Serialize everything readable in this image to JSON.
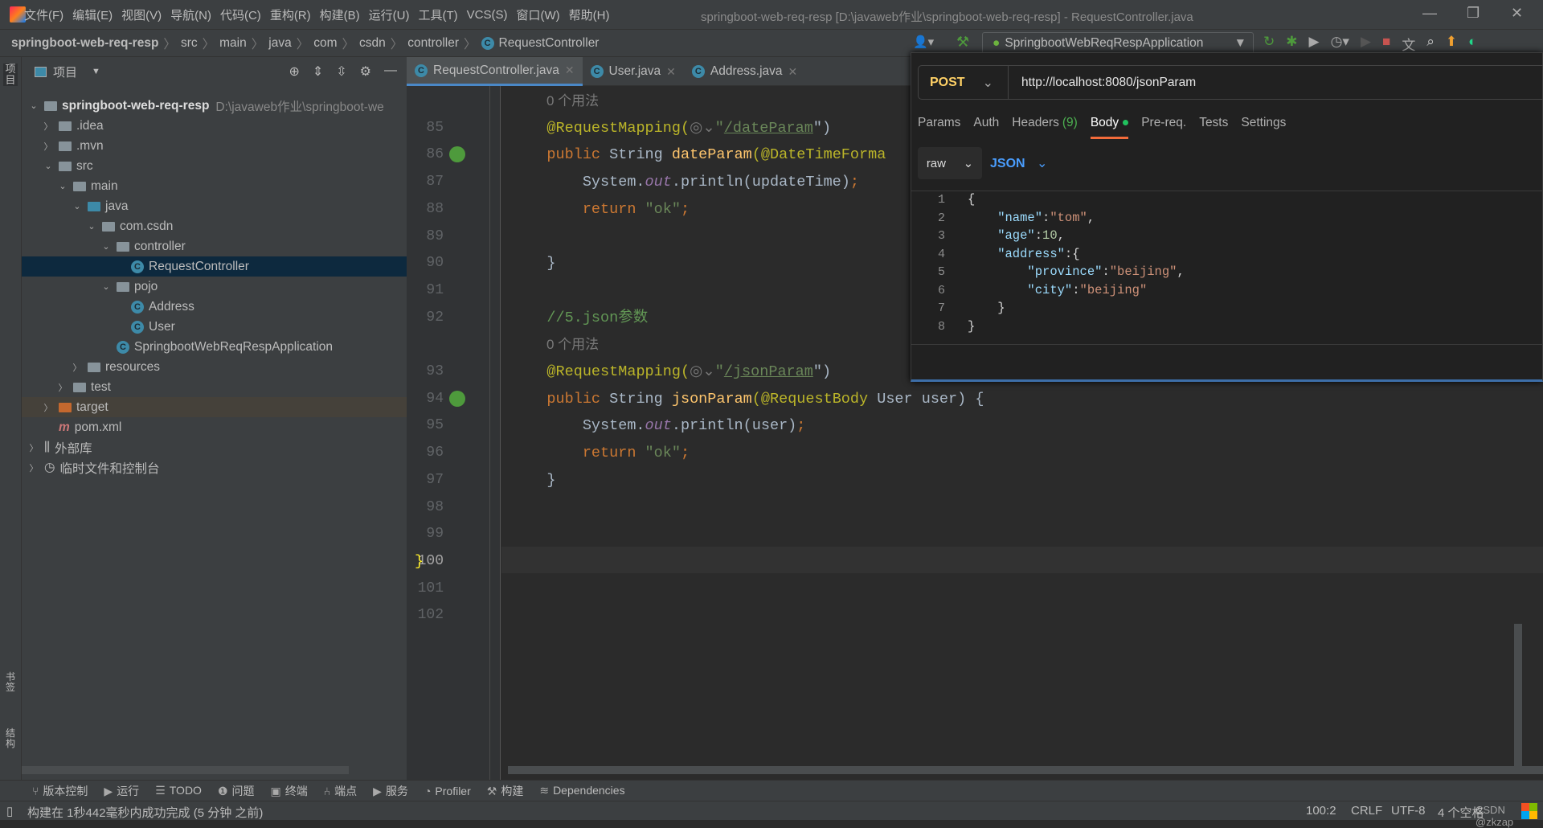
{
  "menu": [
    "文件(F)",
    "编辑(E)",
    "视图(V)",
    "导航(N)",
    "代码(C)",
    "重构(R)",
    "构建(B)",
    "运行(U)",
    "工具(T)",
    "VCS(S)",
    "窗口(W)",
    "帮助(H)"
  ],
  "window_title": "springboot-web-req-resp [D:\\javaweb作业\\springboot-web-req-resp] - RequestController.java",
  "breadcrumb": [
    "springboot-web-req-resp",
    "src",
    "main",
    "java",
    "com",
    "csdn",
    "controller",
    "RequestController"
  ],
  "run_config": "SpringbootWebReqRespApplication",
  "left_strip": {
    "project": "项目",
    "bookmarks": "书签",
    "structure": "结构"
  },
  "project_panel": {
    "title": "项目",
    "tree": [
      {
        "label": "springboot-web-req-resp",
        "path": "D:\\javaweb作业\\springboot-we",
        "depth": 0,
        "exp": "v",
        "icon": "module"
      },
      {
        "label": ".idea",
        "depth": 1,
        "exp": ">",
        "icon": "folder"
      },
      {
        "label": ".mvn",
        "depth": 1,
        "exp": ">",
        "icon": "folder"
      },
      {
        "label": "src",
        "depth": 1,
        "exp": "v",
        "icon": "folder"
      },
      {
        "label": "main",
        "depth": 2,
        "exp": "v",
        "icon": "folder"
      },
      {
        "label": "java",
        "depth": 3,
        "exp": "v",
        "icon": "folder-blue"
      },
      {
        "label": "com.csdn",
        "depth": 4,
        "exp": "v",
        "icon": "package"
      },
      {
        "label": "controller",
        "depth": 5,
        "exp": "v",
        "icon": "package"
      },
      {
        "label": "RequestController",
        "depth": 6,
        "exp": "",
        "icon": "class",
        "selected": true
      },
      {
        "label": "pojo",
        "depth": 5,
        "exp": "v",
        "icon": "package"
      },
      {
        "label": "Address",
        "depth": 6,
        "exp": "",
        "icon": "class"
      },
      {
        "label": "User",
        "depth": 6,
        "exp": "",
        "icon": "class"
      },
      {
        "label": "SpringbootWebReqRespApplication",
        "depth": 5,
        "exp": "",
        "icon": "spring-class"
      },
      {
        "label": "resources",
        "depth": 3,
        "exp": ">",
        "icon": "folder"
      },
      {
        "label": "test",
        "depth": 2,
        "exp": ">",
        "icon": "folder"
      },
      {
        "label": "target",
        "depth": 1,
        "exp": ">",
        "icon": "folder-orange",
        "target": true
      },
      {
        "label": "pom.xml",
        "depth": 1,
        "exp": "",
        "icon": "maven"
      },
      {
        "label": "外部库",
        "depth": 0,
        "exp": ">",
        "icon": "library"
      },
      {
        "label": "临时文件和控制台",
        "depth": 0,
        "exp": ">",
        "icon": "scratch"
      }
    ]
  },
  "tabs": [
    {
      "label": "RequestController.java",
      "active": true
    },
    {
      "label": "User.java"
    },
    {
      "label": "Address.java"
    }
  ],
  "code_lines": [
    {
      "type": "hint",
      "text": "0 个用法"
    },
    {
      "n": "85",
      "tokens": [
        [
          "    ",
          "#555"
        ],
        [
          "@RequestMapping(",
          "#bbb529"
        ],
        [
          "◎⌄",
          "#777"
        ],
        [
          "\"",
          "#6a8759"
        ],
        [
          "/dateParam",
          "#6a8759"
        ],
        [
          "\")",
          "#a9b7c6"
        ]
      ]
    },
    {
      "n": "86",
      "run": true,
      "tokens": [
        [
          "    ",
          "#555"
        ],
        [
          "public ",
          "#cc7832"
        ],
        [
          "String ",
          "#a9b7c6"
        ],
        [
          "dateParam",
          "#ffc66d"
        ],
        [
          "(@DateTimeForma",
          "#bbb529"
        ]
      ]
    },
    {
      "n": "87",
      "tokens": [
        [
          "        System.",
          "#a9b7c6"
        ],
        [
          "out",
          "#9876aa"
        ],
        [
          ".println(updateTime)",
          "#a9b7c6"
        ],
        [
          ";",
          "#cc7832"
        ]
      ]
    },
    {
      "n": "88",
      "tokens": [
        [
          "        ",
          "#555"
        ],
        [
          "return ",
          "#cc7832"
        ],
        [
          "\"ok\"",
          "#6a8759"
        ],
        [
          ";",
          "#cc7832"
        ]
      ]
    },
    {
      "n": "89",
      "tokens": []
    },
    {
      "n": "90",
      "tokens": [
        [
          "    }",
          "#a9b7c6"
        ]
      ]
    },
    {
      "n": "91",
      "tokens": []
    },
    {
      "n": "92",
      "tokens": [
        [
          "    //5.json参数",
          "#629755"
        ]
      ]
    },
    {
      "type": "hint",
      "text": "0 个用法"
    },
    {
      "n": "93",
      "tokens": [
        [
          "    ",
          "#555"
        ],
        [
          "@RequestMapping(",
          "#bbb529"
        ],
        [
          "◎⌄",
          "#777"
        ],
        [
          "\"",
          "#6a8759"
        ],
        [
          "/jsonParam",
          "#6a8759"
        ],
        [
          "\")",
          "#a9b7c6"
        ]
      ]
    },
    {
      "n": "94",
      "run": true,
      "tokens": [
        [
          "    ",
          "#555"
        ],
        [
          "public ",
          "#cc7832"
        ],
        [
          "String ",
          "#a9b7c6"
        ],
        [
          "jsonParam",
          "#ffc66d"
        ],
        [
          "(@RequestBody ",
          "#bbb529"
        ],
        [
          "User user) {",
          "#a9b7c6"
        ]
      ]
    },
    {
      "n": "95",
      "tokens": [
        [
          "        System.",
          "#a9b7c6"
        ],
        [
          "out",
          "#9876aa"
        ],
        [
          ".println(user)",
          "#a9b7c6"
        ],
        [
          ";",
          "#cc7832"
        ]
      ]
    },
    {
      "n": "96",
      "tokens": [
        [
          "        ",
          "#555"
        ],
        [
          "return ",
          "#cc7832"
        ],
        [
          "\"ok\"",
          "#6a8759"
        ],
        [
          ";",
          "#cc7832"
        ]
      ]
    },
    {
      "n": "97",
      "tokens": [
        [
          "    }",
          "#a9b7c6"
        ]
      ]
    },
    {
      "n": "98",
      "tokens": []
    },
    {
      "n": "99",
      "tokens": []
    },
    {
      "n": "100",
      "current": true,
      "tokens": [
        [
          "}",
          "#ffef28"
        ]
      ]
    },
    {
      "n": "101",
      "tokens": []
    },
    {
      "n": "102",
      "tokens": []
    }
  ],
  "postman": {
    "method": "POST",
    "url": "http://localhost:8080/jsonParam",
    "tabs": [
      {
        "label": "Params"
      },
      {
        "label": "Auth"
      },
      {
        "label": "Headers",
        "count": "(9)"
      },
      {
        "label": "Body",
        "active": true
      },
      {
        "label": "Pre-req."
      },
      {
        "label": "Tests"
      },
      {
        "label": "Settings"
      }
    ],
    "body_mode": "raw",
    "body_lang": "JSON",
    "body_lines": [
      [
        [
          "{",
          "#d4d4d4"
        ]
      ],
      [
        [
          "    \"name\"",
          "#9cdcfe"
        ],
        [
          ":",
          "#d4d4d4"
        ],
        [
          "\"tom\"",
          "#ce9178"
        ],
        [
          ",",
          "#d4d4d4"
        ]
      ],
      [
        [
          "    \"age\"",
          "#9cdcfe"
        ],
        [
          ":",
          "#d4d4d4"
        ],
        [
          "10",
          "#b5cea8"
        ],
        [
          ",",
          "#d4d4d4"
        ]
      ],
      [
        [
          "    \"address\"",
          "#9cdcfe"
        ],
        [
          ":{",
          "#d4d4d4"
        ]
      ],
      [
        [
          "        \"province\"",
          "#9cdcfe"
        ],
        [
          ":",
          "#d4d4d4"
        ],
        [
          "\"beijing\"",
          "#ce9178"
        ],
        [
          ",",
          "#d4d4d4"
        ]
      ],
      [
        [
          "        \"city\"",
          "#9cdcfe"
        ],
        [
          ":",
          "#d4d4d4"
        ],
        [
          "\"beijing\"",
          "#ce9178"
        ]
      ],
      [
        [
          "    }",
          "#d4d4d4"
        ]
      ],
      [
        [
          "}",
          "#d4d4d4"
        ]
      ]
    ]
  },
  "tool_windows": [
    "版本控制",
    "运行",
    "TODO",
    "问题",
    "终端",
    "端点",
    "服务",
    "Profiler",
    "构建",
    "Dependencies"
  ],
  "status": {
    "message": "构建在 1秒442毫秒内成功完成 (5 分钟 之前)",
    "position": "100:2",
    "line_sep": "CRLF",
    "encoding": "UTF-8",
    "indent": "4 个空格",
    "watermark": "CSDN @zkzap"
  }
}
